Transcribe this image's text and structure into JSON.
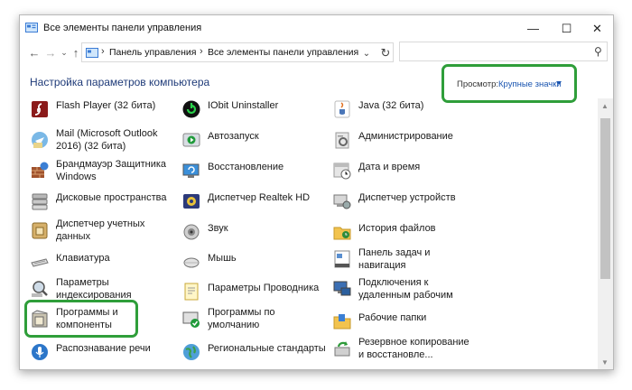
{
  "window": {
    "title": "Все элементы панели управления",
    "minimize_label": "—",
    "maximize_label": "☐",
    "close_label": "✕"
  },
  "nav": {
    "breadcrumb": [
      "Панель управления",
      "Все элементы панели управления"
    ],
    "search_placeholder": ""
  },
  "header": {
    "title": "Настройка параметров компьютера",
    "view_label": "Просмотр:",
    "view_value": "Крупные значки"
  },
  "items": [
    {
      "label": "Flash Player (32 бита)",
      "icon": "flash-player-icon"
    },
    {
      "label": "IObit Uninstaller",
      "icon": "iobit-uninstaller-icon"
    },
    {
      "label": "Java (32 бита)",
      "icon": "java-icon"
    },
    {
      "label": "Mail (Microsoft Outlook 2016) (32 бита)",
      "icon": "mail-icon"
    },
    {
      "label": "Автозапуск",
      "icon": "autoplay-icon"
    },
    {
      "label": "Администрирование",
      "icon": "administration-icon"
    },
    {
      "label": "Брандмауэр Защитника Windows",
      "icon": "firewall-icon"
    },
    {
      "label": "Восстановление",
      "icon": "recovery-icon"
    },
    {
      "label": "Дата и время",
      "icon": "date-time-icon"
    },
    {
      "label": "Дисковые пространства",
      "icon": "storage-spaces-icon"
    },
    {
      "label": "Диспетчер Realtek HD",
      "icon": "realtek-icon"
    },
    {
      "label": "Диспетчер устройств",
      "icon": "device-manager-icon"
    },
    {
      "label": "Диспетчер учетных данных",
      "icon": "credential-manager-icon"
    },
    {
      "label": "Звук",
      "icon": "sound-icon"
    },
    {
      "label": "История файлов",
      "icon": "file-history-icon"
    },
    {
      "label": "Клавиатура",
      "icon": "keyboard-icon"
    },
    {
      "label": "Мышь",
      "icon": "mouse-icon"
    },
    {
      "label": "Панель задач и навигация",
      "icon": "taskbar-icon"
    },
    {
      "label": "Параметры индексирования",
      "icon": "indexing-icon"
    },
    {
      "label": "Параметры Проводника",
      "icon": "explorer-options-icon"
    },
    {
      "label": "Подключения к удаленным рабочим",
      "icon": "remote-desktop-icon"
    },
    {
      "label": "Программы и компоненты",
      "icon": "programs-features-icon"
    },
    {
      "label": "Программы по умолчанию",
      "icon": "default-programs-icon"
    },
    {
      "label": "Рабочие папки",
      "icon": "work-folders-icon"
    },
    {
      "label": "Распознавание речи",
      "icon": "speech-recognition-icon"
    },
    {
      "label": "Региональные стандарты",
      "icon": "region-icon"
    },
    {
      "label": "Резервное копирование и восстановле...",
      "icon": "backup-icon"
    }
  ],
  "colors": {
    "highlight": "#2f9e3a",
    "heading": "#1e3a78",
    "link": "#1a55b0"
  }
}
